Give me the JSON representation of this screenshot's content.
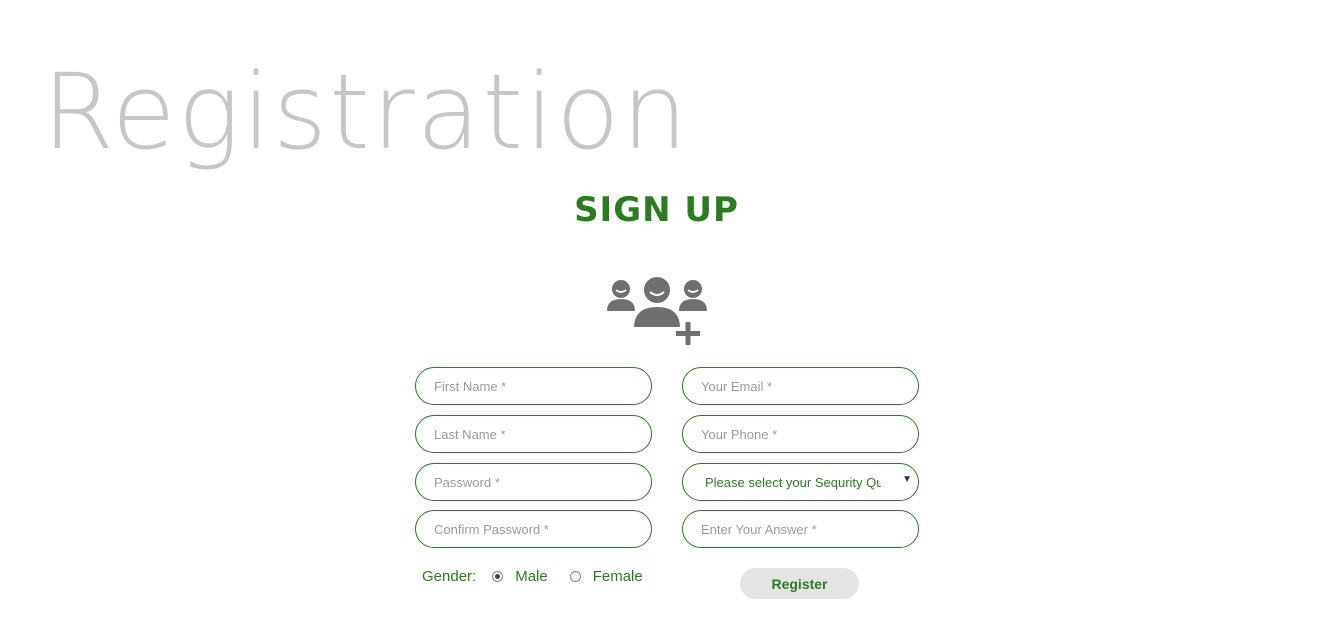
{
  "page": {
    "title": "Registration",
    "heading": "SIGN UP"
  },
  "icons": {
    "header_icon": "add-users-icon"
  },
  "form": {
    "first_name_placeholder": "First Name *",
    "last_name_placeholder": "Last Name *",
    "password_placeholder": "Password *",
    "confirm_password_placeholder": "Confirm Password *",
    "email_placeholder": "Your Email *",
    "phone_placeholder": "Your Phone *",
    "security_question_selected": "Please select your Sequrity Question",
    "answer_placeholder": "Enter Your Answer *",
    "gender_label": "Gender:",
    "gender_options": [
      {
        "label": "Male",
        "checked": true
      },
      {
        "label": "Female",
        "checked": false
      }
    ],
    "register_label": "Register"
  },
  "colors": {
    "accent": "#2a7d1f",
    "title_gray": "#c6c6c6",
    "icon_gray": "#6f6f6f",
    "button_bg": "#e4e4e4"
  }
}
